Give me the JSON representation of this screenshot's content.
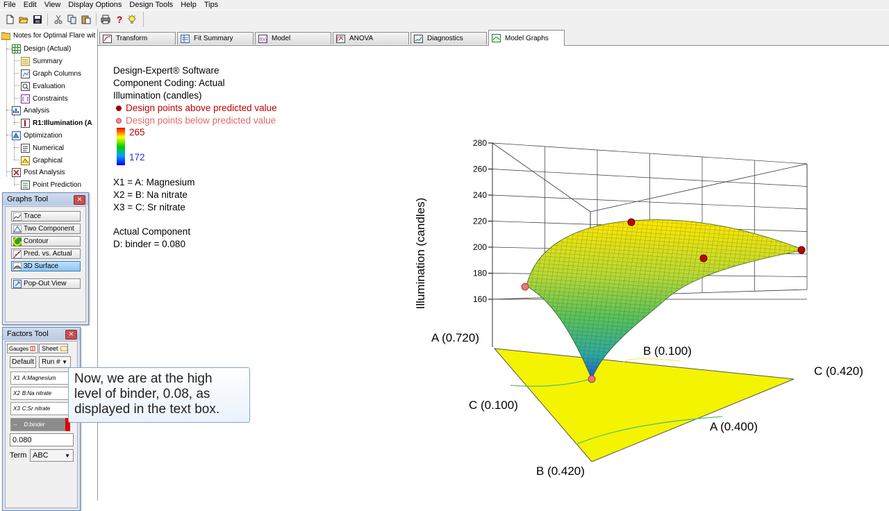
{
  "menu": [
    "File",
    "Edit",
    "View",
    "Display Options",
    "Design Tools",
    "Help",
    "Tips"
  ],
  "toolbar": {
    "icons": [
      "new-icon",
      "open-icon",
      "save-icon",
      "cut-icon",
      "copy-icon",
      "paste-icon",
      "print-icon",
      "help-icon",
      "tip-icon"
    ]
  },
  "tree": {
    "root": "Notes for Optimal Flare wit",
    "design": "Design (Actual)",
    "summary": "Summary",
    "graph_columns": "Graph Columns",
    "evaluation": "Evaluation",
    "constraints": "Constraints",
    "analysis": "Analysis",
    "r1": "R1:Illumination (A",
    "optimization": "Optimization",
    "numerical": "Numerical",
    "graphical": "Graphical",
    "post_analysis": "Post Analysis",
    "point_prediction": "Point Prediction"
  },
  "graphs_tool": {
    "title": "Graphs Tool",
    "buttons": [
      "Trace",
      "Two Component",
      "Contour",
      "Pred. vs. Actual",
      "3D Surface"
    ],
    "popout": "Pop-Out View"
  },
  "factors_tool": {
    "title": "Factors Tool",
    "tab_gauges": "Gauges",
    "tab_sheet": "Sheet",
    "default": "Default",
    "run": "Run #",
    "x1_prefix": "X1",
    "x1": "A:Magnesium",
    "x2_prefix": "X2",
    "x2": "B:Na nitrate",
    "x3_prefix": "X3",
    "x3": "C:Sr nitrate",
    "d_prefix": "--",
    "d": "D:binder",
    "value": "0.080",
    "term_label": "Term",
    "term_value": "ABC"
  },
  "tabs": [
    "Transform",
    "Fit Summary",
    "Model",
    "ANOVA",
    "Diagnostics",
    "Model Graphs"
  ],
  "active_tab": "Model Graphs",
  "legend": {
    "software": "Design-Expert® Software",
    "coding": "Component Coding: Actual",
    "response": "Illumination (candles)",
    "above": "Design points above predicted value",
    "below": "Design points below predicted value",
    "color_max": "265",
    "color_min": "172",
    "x1": "X1 = A: Magnesium",
    "x2": "X2 = B: Na nitrate",
    "x3": "X3 = C: Sr nitrate",
    "actual_component": "Actual Component",
    "binder": "D: binder = 0.080"
  },
  "tooltip": {
    "lines": [
      "Now, we are at the high",
      "level of binder, 0.08, as",
      "displayed in the text box."
    ]
  },
  "chart_data": {
    "type": "surface",
    "zlabel": "Illumination (candles)",
    "zticks": [
      160,
      180,
      200,
      220,
      240,
      260,
      280
    ],
    "zlim": [
      150,
      280
    ],
    "vertex_labels": {
      "a_high": "A (0.720)",
      "b_low": "B (0.100)",
      "c_high": "C (0.420)",
      "c_low": "C (0.100)",
      "a_low": "A (0.400)",
      "b_high": "B (0.420)"
    },
    "design_points": [
      {
        "illumination": 172,
        "position": "below"
      },
      {
        "illumination": 218,
        "position": "above"
      },
      {
        "illumination": 191,
        "position": "above"
      },
      {
        "illumination": 198,
        "position": "above"
      },
      {
        "illumination": 160,
        "position": "below"
      }
    ],
    "colors": {
      "above": "#c00000",
      "below": "#e87878",
      "plane": "#f4f400"
    }
  }
}
